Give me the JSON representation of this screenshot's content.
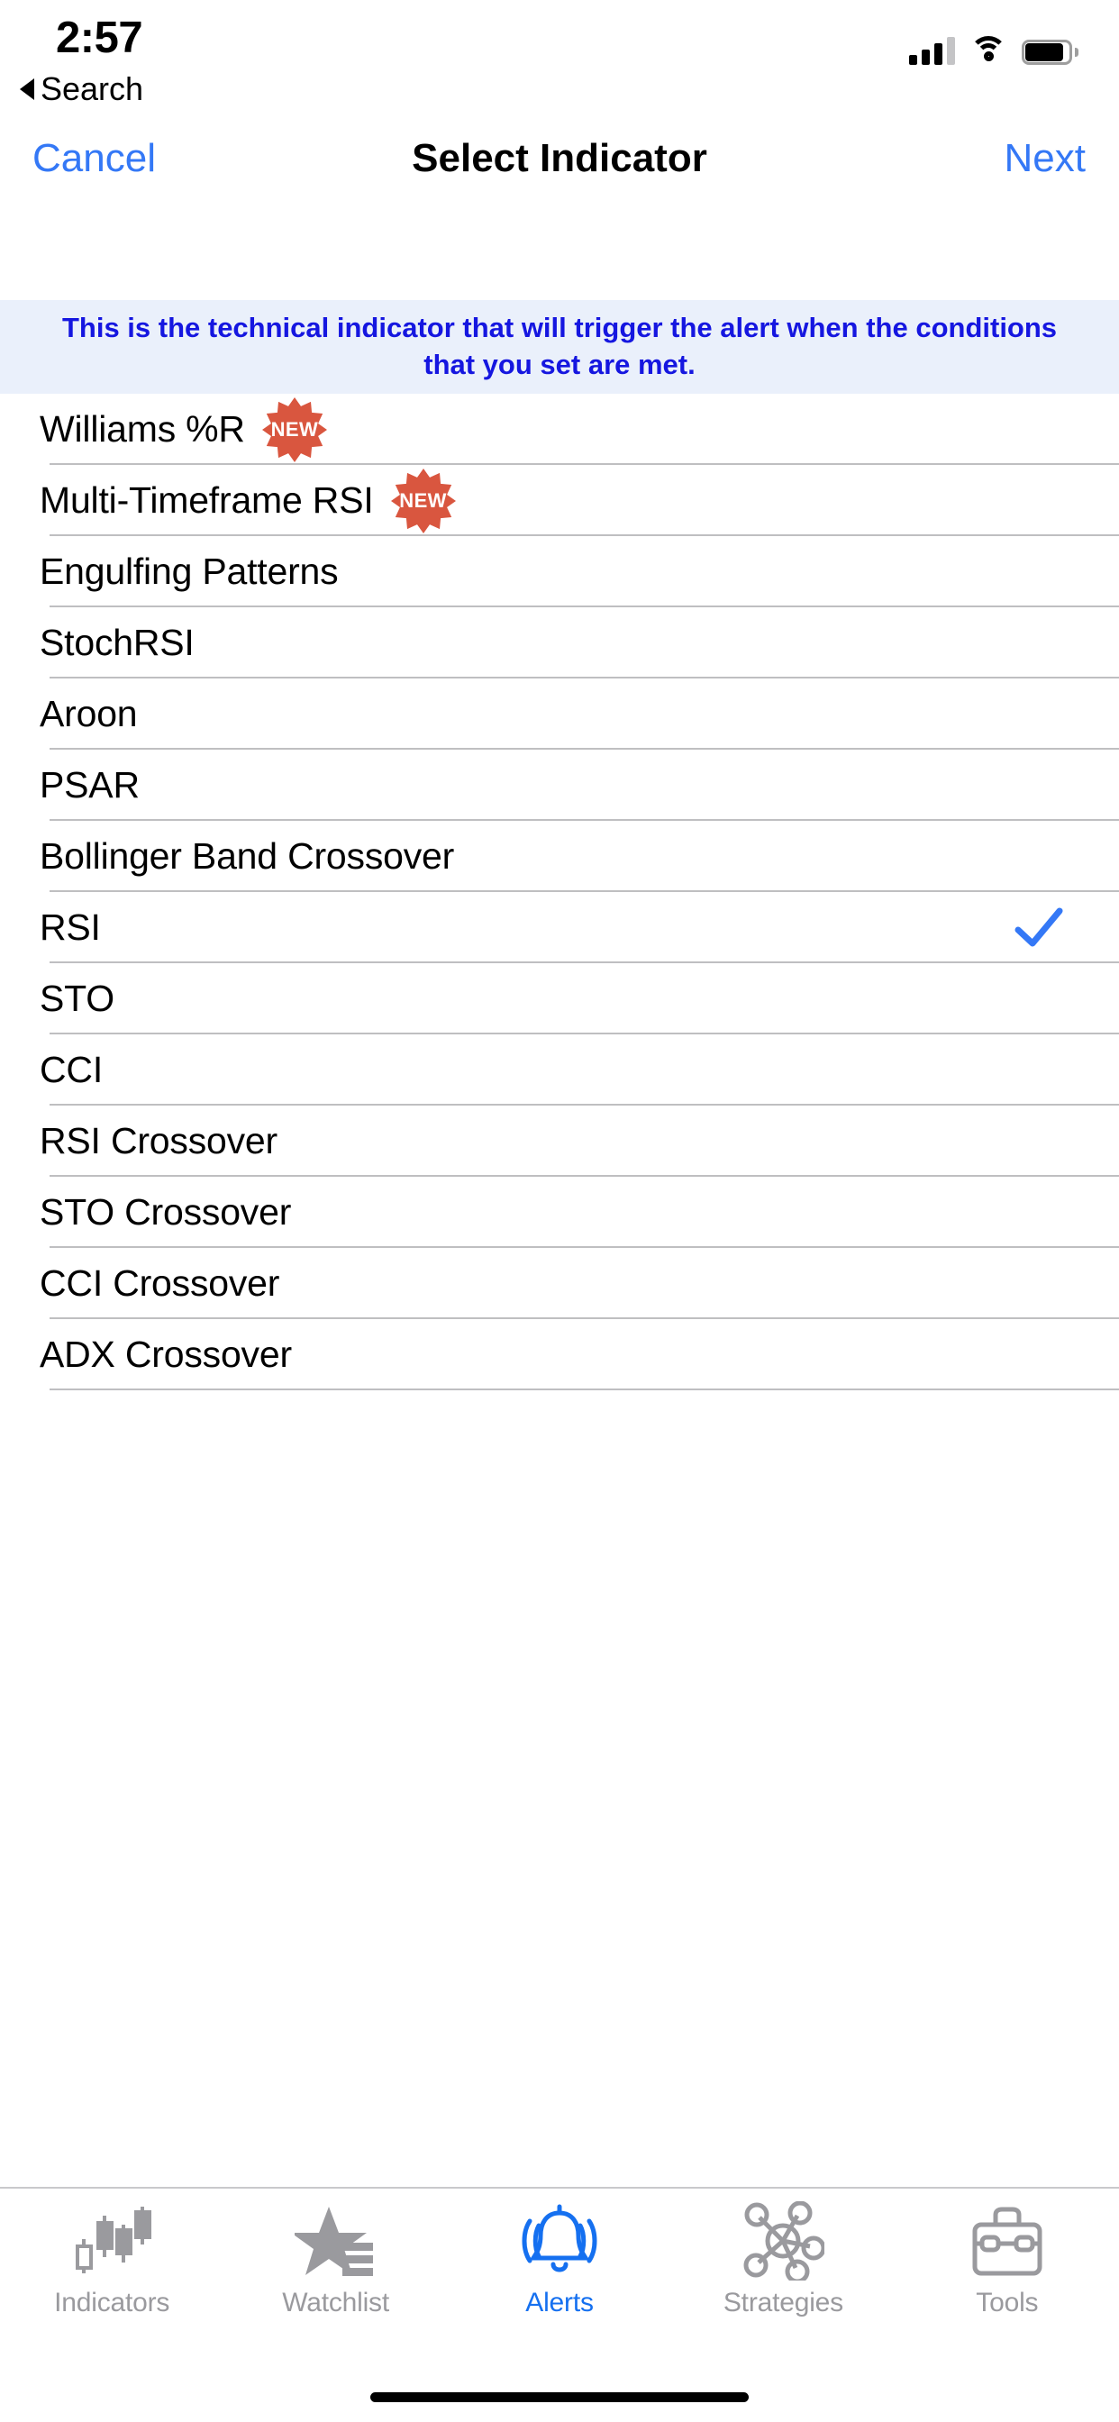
{
  "status_bar": {
    "time": "2:57",
    "back_label": "Search",
    "back_icon": "triangle-left-icon",
    "signal_icon": "cellular-signal-icon",
    "wifi_icon": "wifi-icon",
    "battery_icon": "battery-full-icon"
  },
  "navbar": {
    "cancel_label": "Cancel",
    "title": "Select Indicator",
    "next_label": "Next",
    "tint_color": "#3478F6"
  },
  "banner": {
    "text": "This is the technical indicator that will trigger the alert when the conditions that you set are met.",
    "background_color": "#EAF0FB",
    "text_color": "#1516E0"
  },
  "indicator_list": {
    "selected": "RSI",
    "badge_label": "NEW",
    "badge_color": "#D9563F",
    "checkmark_color": "#3478F6",
    "items": [
      {
        "label": "Williams %R",
        "badge": "NEW",
        "selected": false
      },
      {
        "label": "Multi-Timeframe RSI",
        "badge": "NEW",
        "selected": false
      },
      {
        "label": "Engulfing Patterns",
        "badge": "",
        "selected": false
      },
      {
        "label": "StochRSI",
        "badge": "",
        "selected": false
      },
      {
        "label": "Aroon",
        "badge": "",
        "selected": false
      },
      {
        "label": "PSAR",
        "badge": "",
        "selected": false
      },
      {
        "label": "Bollinger Band Crossover",
        "badge": "",
        "selected": false
      },
      {
        "label": "RSI",
        "badge": "",
        "selected": true
      },
      {
        "label": "STO",
        "badge": "",
        "selected": false
      },
      {
        "label": "CCI",
        "badge": "",
        "selected": false
      },
      {
        "label": "RSI Crossover",
        "badge": "",
        "selected": false
      },
      {
        "label": "STO Crossover",
        "badge": "",
        "selected": false
      },
      {
        "label": "CCI Crossover",
        "badge": "",
        "selected": false
      },
      {
        "label": "ADX Crossover",
        "badge": "",
        "selected": false
      }
    ]
  },
  "tabbar": {
    "active_tab": "Alerts",
    "active_color": "#1570F0",
    "inactive_color": "#9A9A9E",
    "items": [
      {
        "label": "Indicators",
        "icon": "candlestick-chart-icon",
        "active": false
      },
      {
        "label": "Watchlist",
        "icon": "star-list-icon",
        "active": false
      },
      {
        "label": "Alerts",
        "icon": "bell-ringing-icon",
        "active": true
      },
      {
        "label": "Strategies",
        "icon": "network-nodes-icon",
        "active": false
      },
      {
        "label": "Tools",
        "icon": "toolbox-icon",
        "active": false
      }
    ]
  }
}
